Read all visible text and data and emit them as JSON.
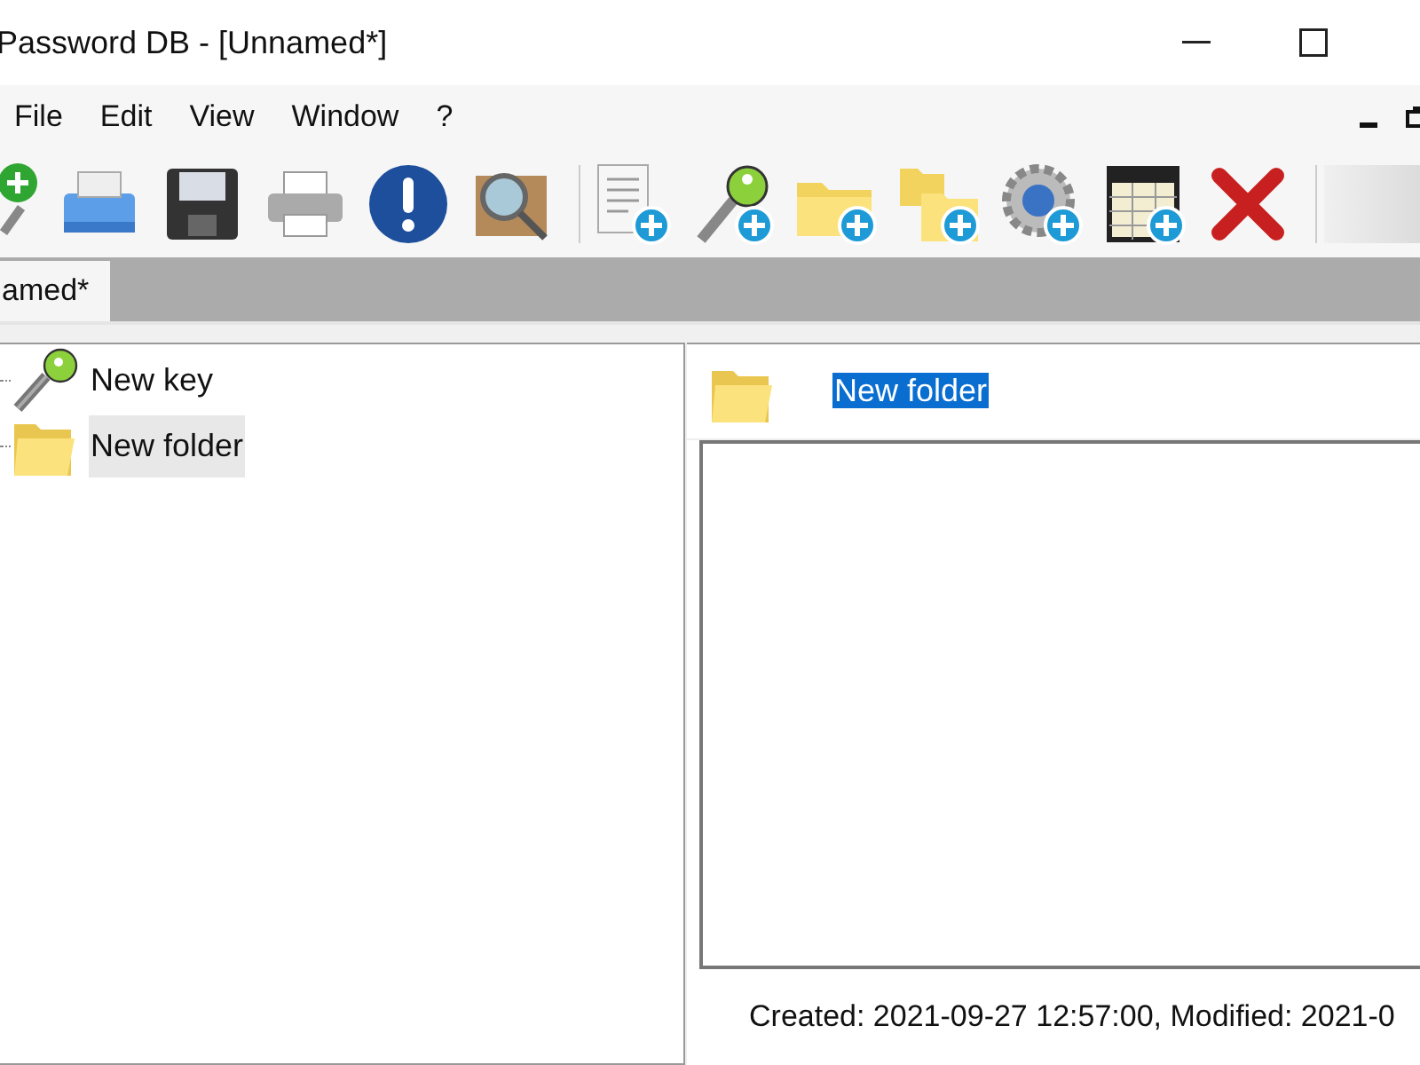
{
  "window": {
    "title": "Password DB - [Unnamed*]"
  },
  "menu": [
    "File",
    "Edit",
    "View",
    "Window",
    "?"
  ],
  "tabs": [
    {
      "label": "amed*",
      "selected": true
    }
  ],
  "tree": [
    {
      "kind": "key",
      "label": "New key",
      "selected": false
    },
    {
      "kind": "folder",
      "label": "New folder",
      "selected": true
    }
  ],
  "details": {
    "kind": "folder",
    "name": "New folder",
    "name_selected": true
  },
  "status_bar": {
    "text": "Created: 2021-09-27 12:57:00, Modified: 2021-0"
  }
}
